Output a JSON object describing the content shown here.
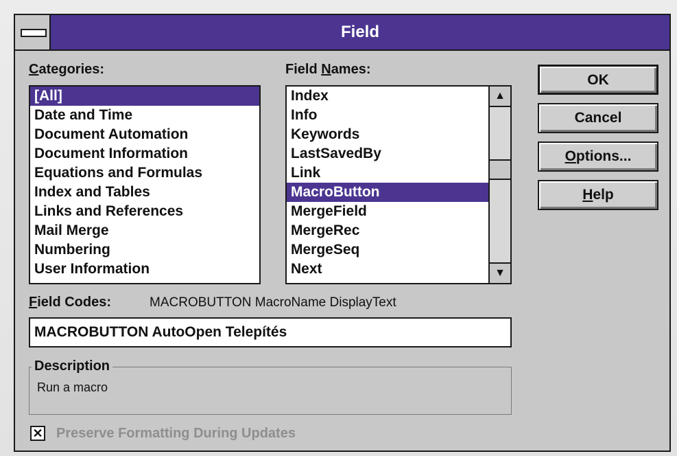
{
  "dialog": {
    "title": "Field"
  },
  "categories": {
    "label_prefix": "C",
    "label_rest": "ategories:",
    "items": [
      "[All]",
      "Date and Time",
      "Document Automation",
      "Document Information",
      "Equations and Formulas",
      "Index and Tables",
      "Links and References",
      "Mail Merge",
      "Numbering",
      "User Information"
    ]
  },
  "field_names": {
    "label_before": "Field ",
    "label_u": "N",
    "label_after": "ames:",
    "items": [
      "Index",
      "Info",
      "Keywords",
      "LastSavedBy",
      "Link",
      "MacroButton",
      "MergeField",
      "MergeRec",
      "MergeSeq",
      "Next"
    ]
  },
  "buttons": {
    "ok": "OK",
    "cancel": "Cancel",
    "options_u": "O",
    "options_rest": "ptions...",
    "help_u": "H",
    "help_rest": "elp"
  },
  "field_codes": {
    "label_u": "F",
    "label_rest": "ield Codes:",
    "syntax": "MACROBUTTON MacroName DisplayText",
    "value": "MACROBUTTON AutoOpen Telepítés"
  },
  "description": {
    "title": "Description",
    "text": "Run a macro"
  },
  "preserve_formatting": {
    "checked_mark": "✕",
    "label": "Preserve Formatting During Updates"
  },
  "icons": {
    "system_menu": "system-menu-icon",
    "scroll_up": "scroll-up-arrow-icon",
    "scroll_down": "scroll-down-arrow-icon"
  },
  "colors": {
    "titlebar": "#4b3591",
    "selection": "#4b3591",
    "dialog_face": "#c8c8c8"
  }
}
